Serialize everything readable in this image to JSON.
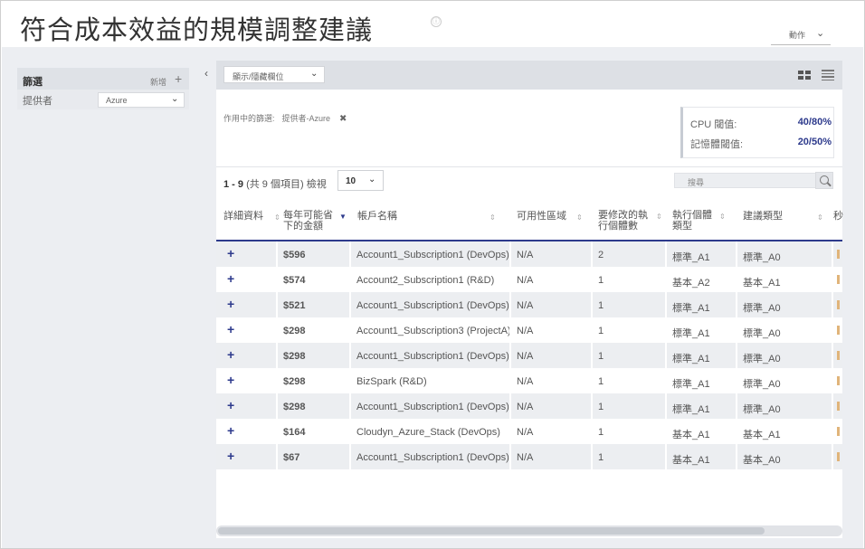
{
  "header": {
    "title": "符合成本效益的規模調整建議",
    "info_icon": "ⓘ",
    "actions_label": "動作",
    "chevron": "⌄"
  },
  "filters": {
    "title": "篩選",
    "add_label": "新增",
    "add_icon": "+",
    "rows": [
      {
        "label": "提供者",
        "value": "Azure"
      }
    ]
  },
  "collapse_icon": "‹",
  "toolbar": {
    "column_toggle_label": "顯示/隱藏欄位"
  },
  "active_filters": {
    "label": "作用中的篩選:",
    "value": "提供者-Azure",
    "remove_icon": "✖"
  },
  "thresholds": {
    "cpu_label": "CPU 閾值:",
    "cpu_value": "40/80%",
    "mem_label": "記憶體閾值:",
    "mem_value": "20/50%"
  },
  "paging": {
    "range": "1 - 9",
    "total": "(共 9 個項目)",
    "view_label": "檢視",
    "page_size": "10"
  },
  "search": {
    "placeholder": "搜尋"
  },
  "table": {
    "columns": [
      {
        "label": "詳細資料"
      },
      {
        "label": "每年可能省",
        "label2": "下的金額"
      },
      {
        "label": "帳戶名稱"
      },
      {
        "label": "可用性區域"
      },
      {
        "label": "要修改的執",
        "label2": "行個體數"
      },
      {
        "label": "執行個體",
        "label2": "類型"
      },
      {
        "label": "建議類型"
      },
      {
        "label": "秒"
      }
    ],
    "sort_icon": "⇕",
    "sort_active_icon": "▼",
    "expand_icon": "+",
    "rows": [
      {
        "amount": "$596",
        "account": "Account1_Subscription1 (DevOps)",
        "zone": "N/A",
        "count": "2",
        "type": "標準_A1",
        "rec": "標準_A0"
      },
      {
        "amount": "$574",
        "account": "Account2_Subscription1 (R&D)",
        "zone": "N/A",
        "count": "1",
        "type": "基本_A2",
        "rec": "基本_A1"
      },
      {
        "amount": "$521",
        "account": "Account1_Subscription1 (DevOps)",
        "zone": "N/A",
        "count": "1",
        "type": "標準_A1",
        "rec": "標準_A0"
      },
      {
        "amount": "$298",
        "account": "Account1_Subscription3 (ProjectA)",
        "zone": "N/A",
        "count": "1",
        "type": "標準_A1",
        "rec": "標準_A0"
      },
      {
        "amount": "$298",
        "account": "Account1_Subscription1 (DevOps)",
        "zone": "N/A",
        "count": "1",
        "type": "標準_A1",
        "rec": "標準_A0"
      },
      {
        "amount": "$298",
        "account": "BizSpark (R&D)",
        "zone": "N/A",
        "count": "1",
        "type": "標準_A1",
        "rec": "標準_A0"
      },
      {
        "amount": "$298",
        "account": "Account1_Subscription1 (DevOps)",
        "zone": "N/A",
        "count": "1",
        "type": "標準_A1",
        "rec": "標準_A0"
      },
      {
        "amount": "$164",
        "account": "Cloudyn_Azure_Stack (DevOps)",
        "zone": "N/A",
        "count": "1",
        "type": "基本_A1",
        "rec": "基本_A1"
      },
      {
        "amount": "$67",
        "account": "Account1_Subscription1 (DevOps)",
        "zone": "N/A",
        "count": "1",
        "type": "基本_A1",
        "rec": "基本_A0"
      }
    ]
  }
}
